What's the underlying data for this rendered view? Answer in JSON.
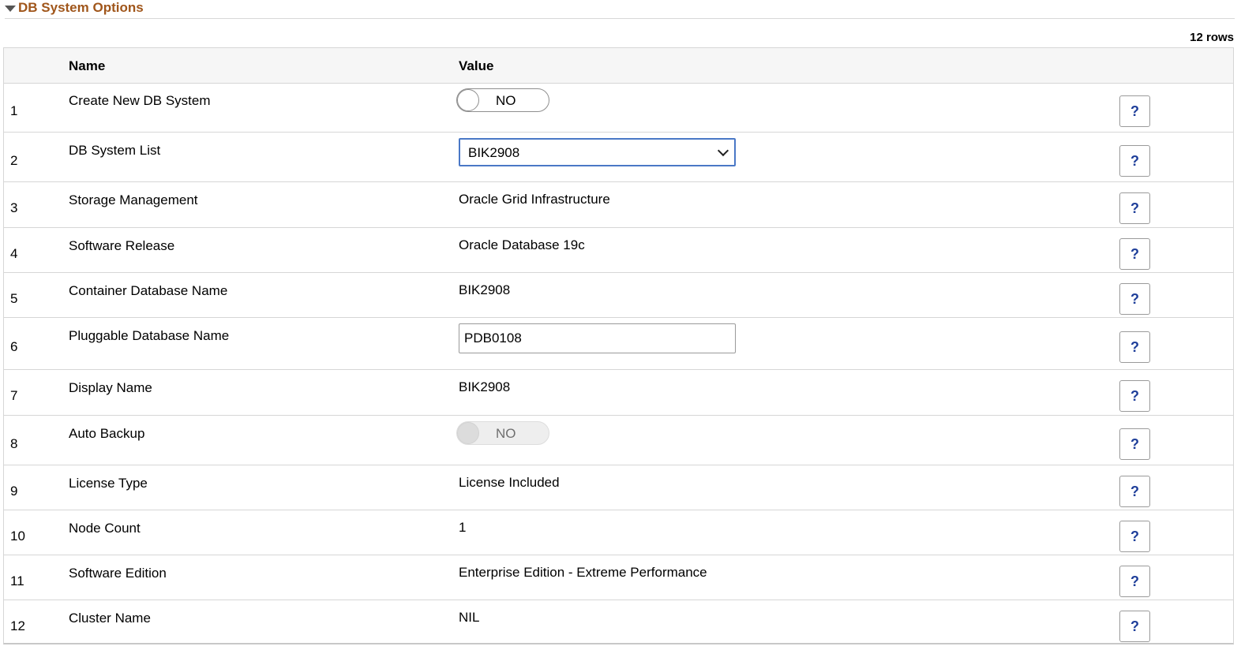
{
  "section": {
    "title": "DB System Options"
  },
  "grid": {
    "row_count_label": "12 rows",
    "columns": {
      "name": "Name",
      "value": "Value"
    },
    "help_label": "?",
    "rows": [
      {
        "num": "1",
        "name": "Create New DB System",
        "type": "toggle",
        "value": "NO",
        "disabled": false
      },
      {
        "num": "2",
        "name": "DB System List",
        "type": "select",
        "value": "BIK2908"
      },
      {
        "num": "3",
        "name": "Storage Management",
        "type": "text",
        "value": "Oracle Grid Infrastructure"
      },
      {
        "num": "4",
        "name": "Software Release",
        "type": "text",
        "value": "Oracle Database 19c"
      },
      {
        "num": "5",
        "name": "Container Database Name",
        "type": "text",
        "value": "BIK2908"
      },
      {
        "num": "6",
        "name": "Pluggable Database Name",
        "type": "input",
        "value": "PDB0108"
      },
      {
        "num": "7",
        "name": "Display Name",
        "type": "text",
        "value": "BIK2908"
      },
      {
        "num": "8",
        "name": "Auto Backup",
        "type": "toggle",
        "value": "NO",
        "disabled": true
      },
      {
        "num": "9",
        "name": "License Type",
        "type": "text",
        "value": "License Included"
      },
      {
        "num": "10",
        "name": "Node Count",
        "type": "text",
        "value": "1"
      },
      {
        "num": "11",
        "name": "Software Edition",
        "type": "text",
        "value": "Enterprise Edition - Extreme Performance"
      },
      {
        "num": "12",
        "name": "Cluster Name",
        "type": "text",
        "value": "NIL"
      }
    ]
  }
}
